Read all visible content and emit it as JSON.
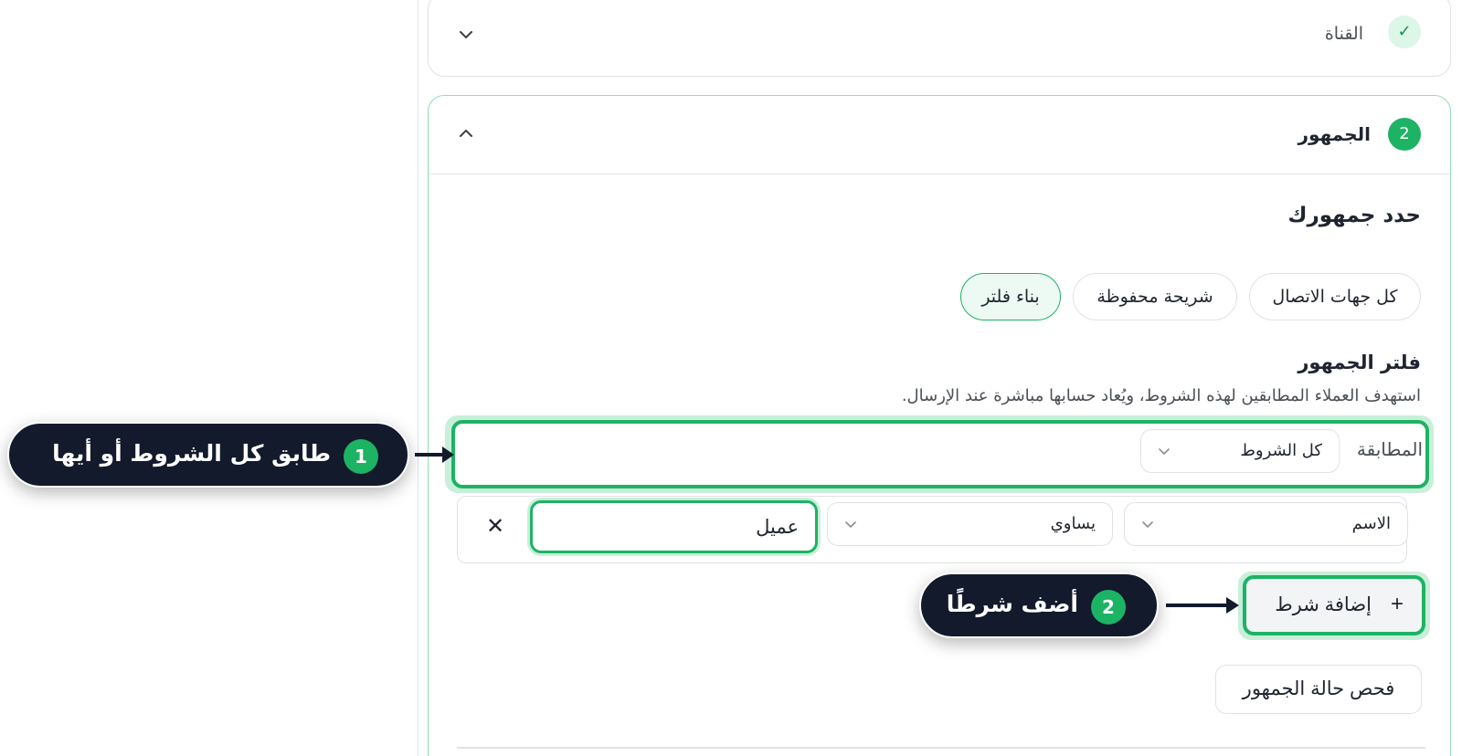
{
  "channel_step": {
    "title": "القناة",
    "status_icon": "check-icon",
    "toggle_icon": "chevron-down-icon"
  },
  "audience_step": {
    "number": "2",
    "title": "الجمهور",
    "toggle_icon": "chevron-up-icon",
    "section_title": "حدد جمهورك",
    "options": [
      {
        "label": "كل جهات الاتصال",
        "selected": false
      },
      {
        "label": "شريحة محفوظة",
        "selected": false
      },
      {
        "label": "بناء فلتر",
        "selected": true
      }
    ],
    "filter": {
      "title": "فلتر الجمهور",
      "description": "استهدف العملاء المطابقين لهذه الشروط، ويُعاد حسابها مباشرة عند الإرسال.",
      "match_label": "المطابقة",
      "match_value": "كل الشروط",
      "condition": {
        "field": "الاسم",
        "operator": "يساوي",
        "value": "عميل"
      },
      "add_condition_label": "إضافة شرط",
      "add_icon": "plus-icon",
      "remove_icon": "close-icon"
    },
    "check_button_label": "فحص حالة الجمهور"
  },
  "callouts": [
    {
      "number": "1",
      "text": "طابق كل الشروط أو أيها"
    },
    {
      "number": "2",
      "text": "أضف شرطًا"
    }
  ],
  "colors": {
    "accent": "#1db364",
    "accent_soft": "#c8efd9",
    "callout_bg": "#121a2c"
  }
}
